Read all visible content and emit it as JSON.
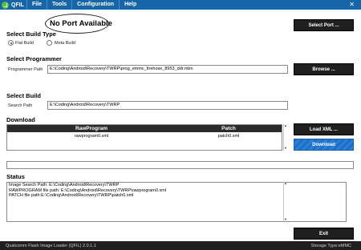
{
  "menubar": {
    "app_name": "QFIL",
    "items": [
      "File",
      "Tools",
      "Configuration",
      "Help"
    ],
    "close_glyph": "✕"
  },
  "port": {
    "label": "No Port Available"
  },
  "buttons": {
    "select_port": "Select Port ...",
    "browse": "Browse ...",
    "load_xml": "Load XML ...",
    "download": "Download",
    "exit": "Exit"
  },
  "build_type": {
    "title": "Select Build Type",
    "options": [
      {
        "label": "Flat Build",
        "selected": true
      },
      {
        "label": "Meta Build",
        "selected": false
      }
    ]
  },
  "programmer": {
    "title": "Select Programmer",
    "label": "Programmer Path",
    "value": "E:\\Coding\\Android\\Recovery\\TWRP\\prog_emmc_firehose_8953_ddr.mbn"
  },
  "build": {
    "title": "Select Build",
    "label": "Search Path",
    "value": "E:\\Coding\\Android\\Recovery\\TWRP"
  },
  "download": {
    "title": "Download",
    "columns": [
      "RawProgram",
      "Patch"
    ],
    "rows": [
      [
        "rawprogram0.xml",
        "patch0.xml"
      ]
    ]
  },
  "status": {
    "title": "Status",
    "lines": [
      "Image Search Path: E:\\Coding\\Android\\Recovery\\TWRP",
      "RAWPROGRAM file path: E:\\Coding\\Android\\Recovery\\TWRP\\rawprogram0.xml",
      "PATCH file path:E:\\Coding\\Android\\Recovery\\TWRP\\patch0.xml"
    ]
  },
  "statusbar": {
    "app_full_name": "Qualcomm Flash Image Loader (QFIL)",
    "version": "2.0.1.1",
    "storage": "Storage Type:eMMC"
  },
  "colors": {
    "menubar_bg": "#1565a8",
    "button_bg": "#1f1f1f",
    "download_button_bg": "#1f6fc7",
    "statusbar_bg": "#1f1f1f"
  }
}
